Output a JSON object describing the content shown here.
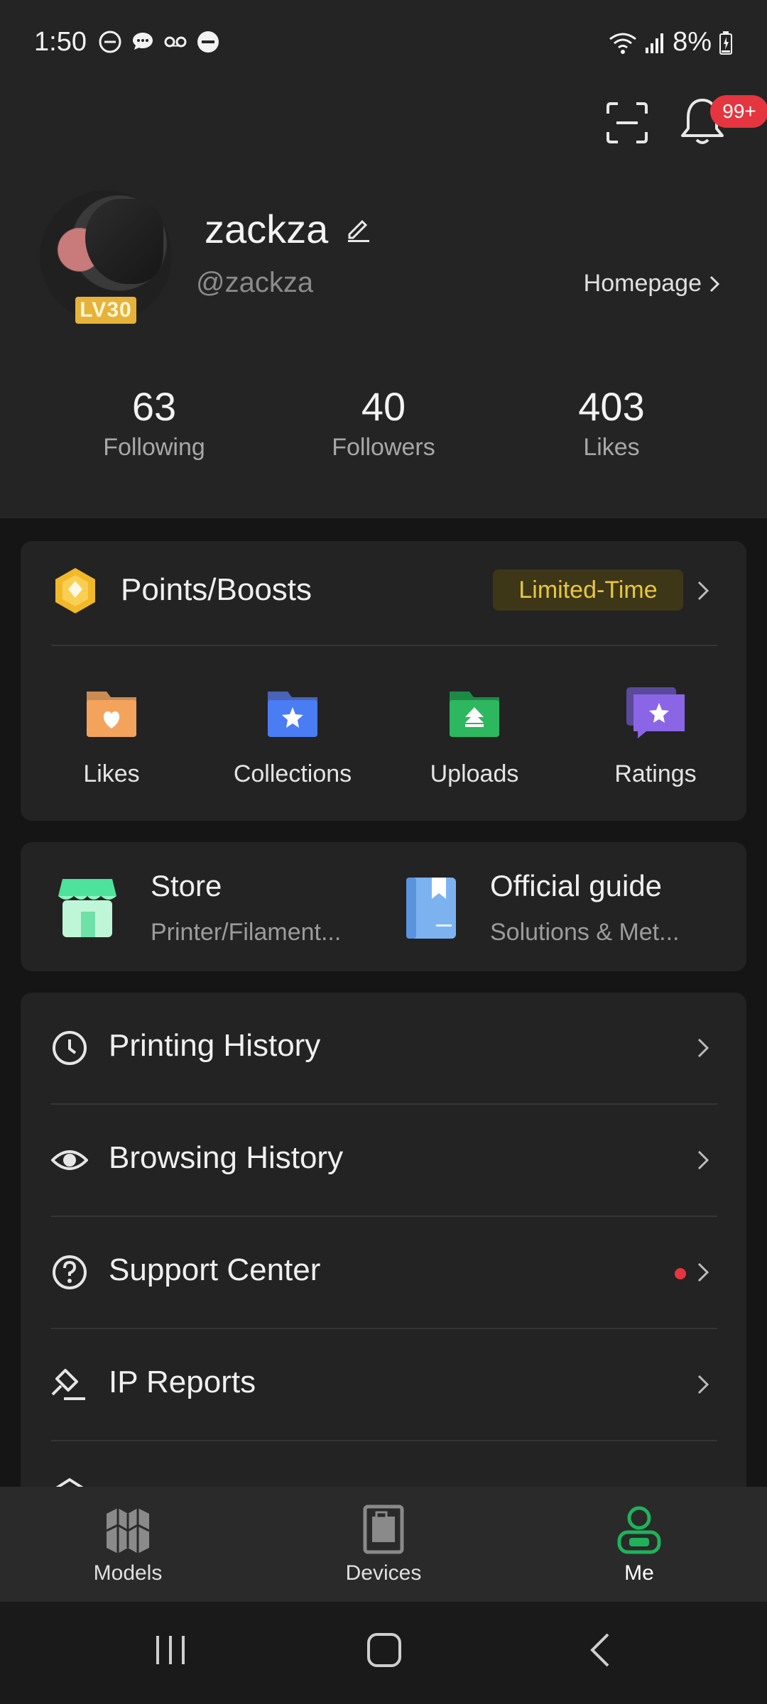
{
  "status_bar": {
    "time": "1:50",
    "battery": "8%"
  },
  "notifications": {
    "badge": "99+"
  },
  "profile": {
    "username": "zackza",
    "handle": "@zackza",
    "level": "LV30",
    "homepage_label": "Homepage"
  },
  "stats": [
    {
      "value": "63",
      "label": "Following"
    },
    {
      "value": "40",
      "label": "Followers"
    },
    {
      "value": "403",
      "label": "Likes"
    }
  ],
  "points": {
    "title": "Points/Boosts",
    "tag": "Limited-Time"
  },
  "quick_links": [
    {
      "label": "Likes",
      "icon": "heart-folder-icon",
      "color": "#f0a050"
    },
    {
      "label": "Collections",
      "icon": "star-folder-icon",
      "color": "#3d6cf0"
    },
    {
      "label": "Uploads",
      "icon": "upload-folder-icon",
      "color": "#26a653"
    },
    {
      "label": "Ratings",
      "icon": "star-chat-icon",
      "color": "#7b5cd6"
    }
  ],
  "store": {
    "title": "Store",
    "subtitle": "Printer/Filament..."
  },
  "guide": {
    "title": "Official guide",
    "subtitle": "Solutions & Met..."
  },
  "menu": [
    {
      "label": "Printing History",
      "icon": "clock-icon"
    },
    {
      "label": "Browsing History",
      "icon": "eye-icon"
    },
    {
      "label": "Support Center",
      "icon": "question-icon"
    },
    {
      "label": "IP Reports",
      "icon": "gavel-icon"
    }
  ],
  "bottom_nav": [
    {
      "label": "Models",
      "icon": "models-icon"
    },
    {
      "label": "Devices",
      "icon": "devices-icon"
    },
    {
      "label": "Me",
      "icon": "me-icon",
      "active_color": "#1fb25a"
    }
  ]
}
